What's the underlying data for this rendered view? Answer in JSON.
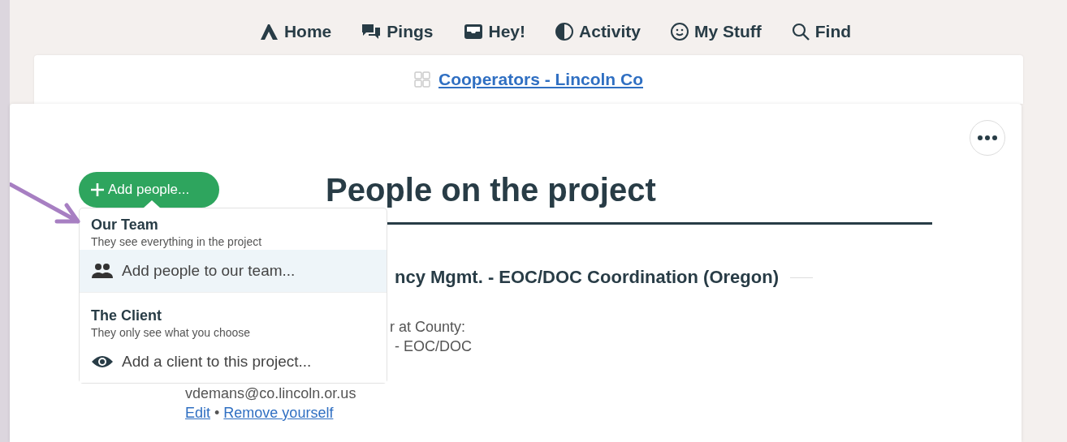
{
  "nav": [
    {
      "label": "Home"
    },
    {
      "label": "Pings"
    },
    {
      "label": "Hey!"
    },
    {
      "label": "Activity"
    },
    {
      "label": "My Stuff"
    },
    {
      "label": "Find"
    }
  ],
  "project": {
    "name": "Cooperators - Lincoln Co"
  },
  "page": {
    "title": "People on the project",
    "add_button": "Add people...",
    "group_heading": "ncy Mgmt. - EOC/DOC Coordination (Oregon)",
    "person": {
      "lines": [
        "r at County:",
        "- EOC/DOC",
        "vdemans@co.lincoln.or.us"
      ],
      "links": [
        "Edit",
        "Remove yourself"
      ],
      "separator": "•"
    }
  },
  "menu": {
    "sections": [
      {
        "title": "Our Team",
        "subtitle": "They see everything in the project",
        "action": "Add people to our team...",
        "highlighted": true
      },
      {
        "title": "The Client",
        "subtitle": "They only see what you choose",
        "action": "Add a client to this project...",
        "highlighted": false
      }
    ]
  }
}
